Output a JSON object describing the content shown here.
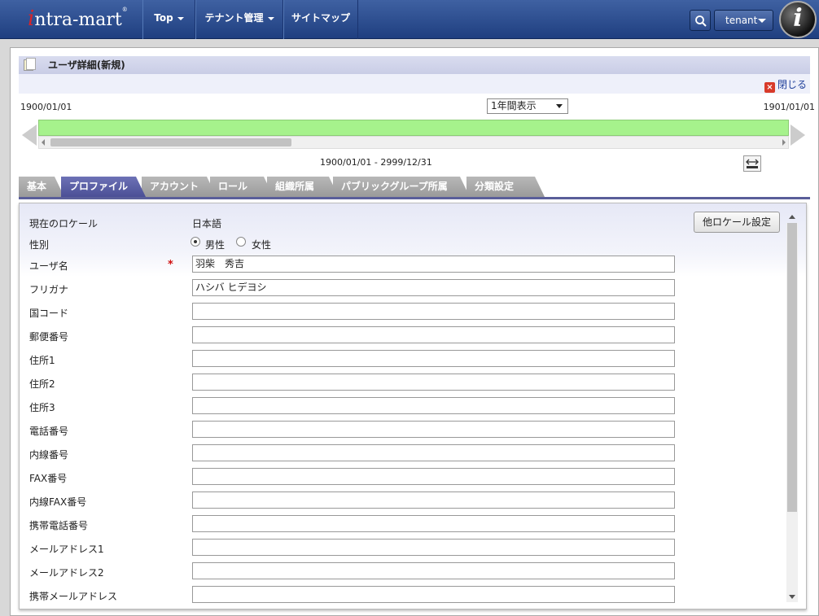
{
  "header": {
    "logo": "intra-mart",
    "nav": [
      {
        "label": "Top",
        "dropdown": true
      },
      {
        "label": "テナント管理",
        "dropdown": true
      },
      {
        "label": "サイトマップ",
        "dropdown": false
      }
    ],
    "tenant_label": "tenant"
  },
  "page": {
    "title": "ユーザ詳細(新規)",
    "close_label": "閉じる"
  },
  "timeline": {
    "start_date": "1900/01/01",
    "end_date": "1901/01/01",
    "period_select": "1年間表示",
    "range": "1900/01/01 - 2999/12/31"
  },
  "tabs": [
    {
      "label": "基本"
    },
    {
      "label": "プロファイル",
      "active": true
    },
    {
      "label": "アカウント"
    },
    {
      "label": "ロール"
    },
    {
      "label": "組織所属"
    },
    {
      "label": "パブリックグループ所属"
    },
    {
      "label": "分類設定"
    }
  ],
  "form": {
    "current_locale_label": "現在のロケール",
    "current_locale_value": "日本語",
    "other_locale_button": "他ロケール設定",
    "gender_label": "性別",
    "gender_options": [
      "男性",
      "女性"
    ],
    "gender_selected": "男性",
    "fields": [
      {
        "label": "ユーザ名",
        "required": true,
        "value": "羽柴　秀吉"
      },
      {
        "label": "フリガナ",
        "value": "ハシバ ヒデヨシ"
      },
      {
        "label": "国コード",
        "value": ""
      },
      {
        "label": "郵便番号",
        "value": ""
      },
      {
        "label": "住所1",
        "value": ""
      },
      {
        "label": "住所2",
        "value": ""
      },
      {
        "label": "住所3",
        "value": ""
      },
      {
        "label": "電話番号",
        "value": ""
      },
      {
        "label": "内線番号",
        "value": ""
      },
      {
        "label": "FAX番号",
        "value": ""
      },
      {
        "label": "内線FAX番号",
        "value": ""
      },
      {
        "label": "携帯電話番号",
        "value": ""
      },
      {
        "label": "メールアドレス1",
        "value": ""
      },
      {
        "label": "メールアドレス2",
        "value": ""
      },
      {
        "label": "携帯メールアドレス",
        "value": ""
      }
    ]
  },
  "colors": {
    "header": "#2d4e90",
    "active_tab": "#5a5e9a",
    "timeline_bar": "#a6f28c",
    "required": "#d01010"
  }
}
